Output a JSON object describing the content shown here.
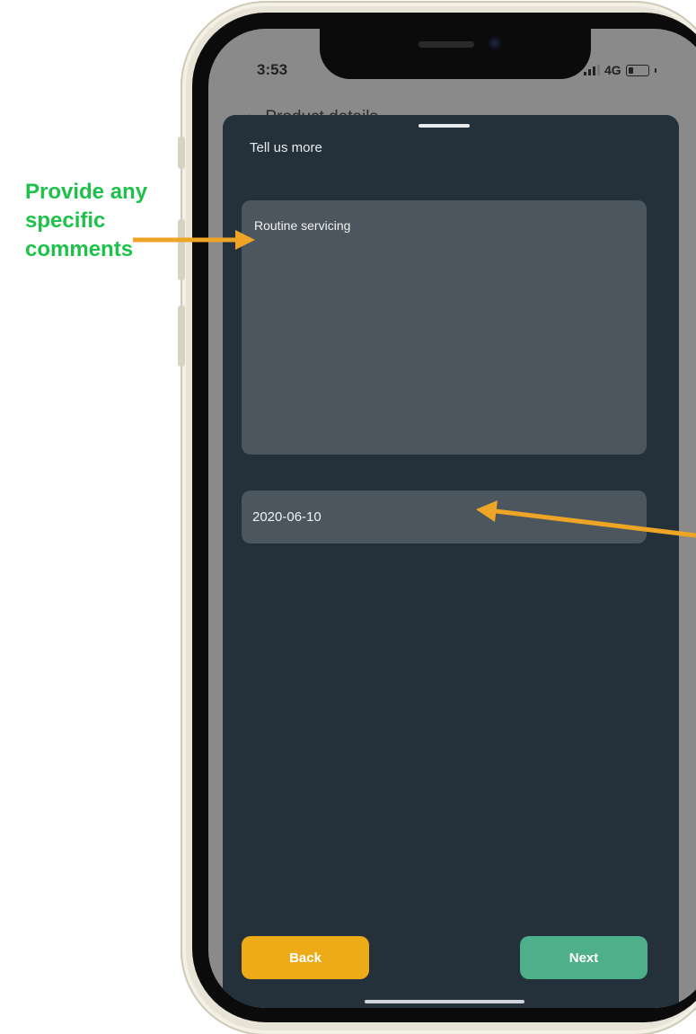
{
  "annotation": {
    "lines": [
      "Provide any",
      "specific",
      "comments"
    ]
  },
  "status_bar": {
    "time": "3:53",
    "network": "4G"
  },
  "header_behind": {
    "title": "Product details"
  },
  "sheet": {
    "title": "Tell us more",
    "comment_value": "Routine servicing",
    "date_value": "2020-06-10",
    "back_label": "Back",
    "next_label": "Next"
  },
  "colors": {
    "annotation_green": "#1ec24a",
    "arrow_orange": "#eea424",
    "sheet_background": "#24313b",
    "field_background": "#4b565e",
    "back_button": "#eeab18",
    "next_button": "#4db08b"
  }
}
